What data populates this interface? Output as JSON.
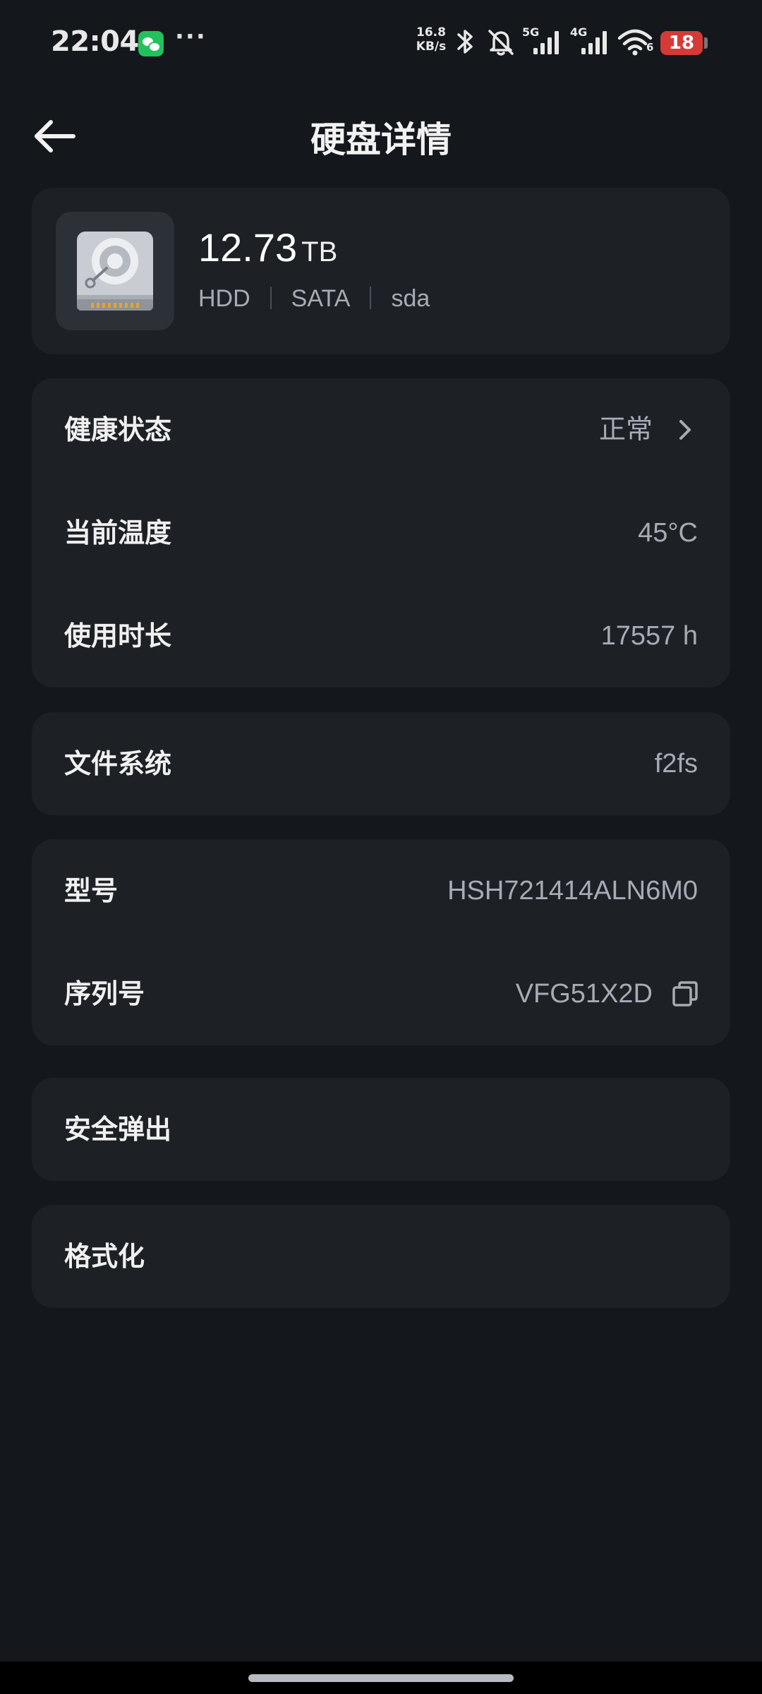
{
  "status_bar": {
    "time": "22:04",
    "more": "···",
    "net_speed_value": "16.8",
    "net_speed_unit": "KB/s",
    "signal_5g": "5G",
    "signal_4g": "4G",
    "wifi_label": "6",
    "battery": "18"
  },
  "header": {
    "title": "硬盘详情"
  },
  "disk": {
    "capacity_value": "12.73",
    "capacity_unit": "TB",
    "type": "HDD",
    "interface": "SATA",
    "device": "sda"
  },
  "health_card": {
    "health_label": "健康状态",
    "health_value": "正常",
    "temp_label": "当前温度",
    "temp_value": "45°C",
    "hours_label": "使用时长",
    "hours_value": "17557 h"
  },
  "fs_card": {
    "label": "文件系统",
    "value": "f2fs"
  },
  "info_card": {
    "model_label": "型号",
    "model_value": "HSH721414ALN6M0",
    "serial_label": "序列号",
    "serial_value": "VFG51X2D"
  },
  "actions": {
    "eject_label": "安全弹出",
    "format_label": "格式化"
  },
  "colors": {
    "background": "#14171b",
    "card": "#1d2025",
    "secondary_text": "#a6acb6",
    "battery_low": "#d63a36"
  }
}
